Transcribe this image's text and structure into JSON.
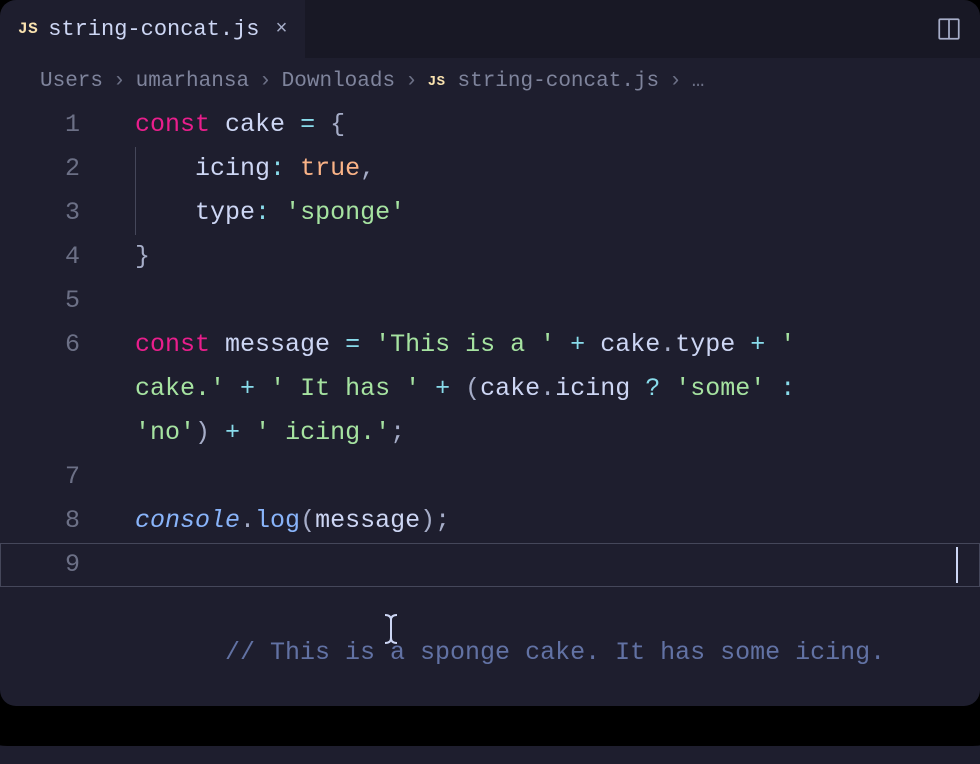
{
  "tab": {
    "icon_label": "JS",
    "filename": "string-concat.js",
    "close_glyph": "×"
  },
  "breadcrumbs": {
    "sep_glyph": "›",
    "items": [
      "Users",
      "umarhansa",
      "Downloads"
    ],
    "file_icon_label": "JS",
    "file": "string-concat.js",
    "overflow_glyph": "…"
  },
  "editor": {
    "line_numbers": [
      "1",
      "2",
      "3",
      "4",
      "5",
      "6",
      "",
      "",
      "7",
      "8",
      "9"
    ],
    "tokens": {
      "kw_const": "const",
      "var_cake": "cake",
      "op_eq": "=",
      "brace_open": "{",
      "prop_icing": "icing",
      "colon": ":",
      "bool_true": "true",
      "comma": ",",
      "prop_type": "type",
      "str_sponge": "'sponge'",
      "brace_close": "}",
      "var_message": "message",
      "str_this_is_a": "'This is a '",
      "op_plus": "+",
      "dot": ".",
      "str_cake_period": "cake.'",
      "str_it_has": "' It has '",
      "paren_open": "(",
      "op_q": "?",
      "str_some": "'some'",
      "op_colon2": ":",
      "str_no": "'no'",
      "paren_close": ")",
      "str_icing_period": "' icing.'",
      "semi": ";",
      "obj_console": "console",
      "fn_log": "log",
      "cmt_line9": "// This is a sponge cake. It has some icing.",
      "open_str_lead": " '"
    }
  }
}
